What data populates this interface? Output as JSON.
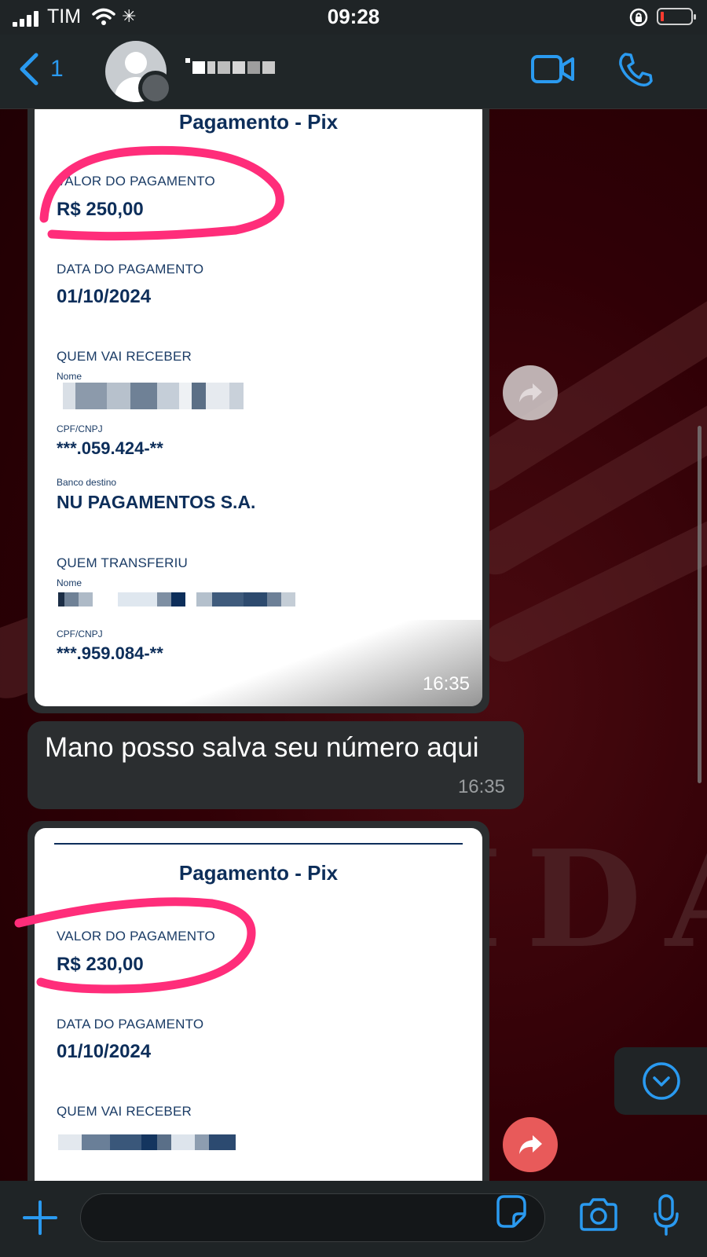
{
  "status_bar": {
    "carrier": "TIM",
    "time": "09:28",
    "battery_color": "#ff3b30"
  },
  "header": {
    "back_count": "1",
    "accent": "#2a9af0"
  },
  "wallpaper": {
    "brand_letters": "IDA"
  },
  "messages": [
    {
      "type": "image",
      "receipt": {
        "title": "Pagamento - Pix",
        "valor_label": "VALOR DO PAGAMENTO",
        "valor": "R$ 250,00",
        "data_label": "DATA DO PAGAMENTO",
        "data": "01/10/2024",
        "recebedor_label": "QUEM VAI RECEBER",
        "nome_label": "Nome",
        "cpf_label": "CPF/CNPJ",
        "cpf_recebedor": "***.059.424-**",
        "banco_label": "Banco destino",
        "banco": "NU PAGAMENTOS S.A.",
        "pagador_label": "QUEM TRANSFERIU",
        "pagador_nome_label": "Nome",
        "pagador_cpf_label": "CPF/CNPJ",
        "cpf_pagador": "***.959.084-**"
      },
      "time": "16:35"
    },
    {
      "type": "text",
      "text": "Mano posso salva seu número aqui",
      "time": "16:35"
    },
    {
      "type": "image",
      "receipt": {
        "title": "Pagamento - Pix",
        "valor_label": "VALOR DO PAGAMENTO",
        "valor": "R$ 230,00",
        "data_label": "DATA DO PAGAMENTO",
        "data": "01/10/2024",
        "recebedor_label": "QUEM VAI RECEBER"
      }
    }
  ],
  "input": {
    "placeholder": ""
  },
  "colors": {
    "highlight": "#ff2d7a",
    "bubble": "#2b2e30",
    "receipt_text": "#0d2e5a",
    "forward_active": "#e85a5a"
  },
  "icons": [
    "back-chevron-icon",
    "video-call-icon",
    "phone-icon",
    "forward-icon",
    "scroll-down-icon",
    "plus-icon",
    "sticker-icon",
    "camera-icon",
    "microphone-icon"
  ]
}
